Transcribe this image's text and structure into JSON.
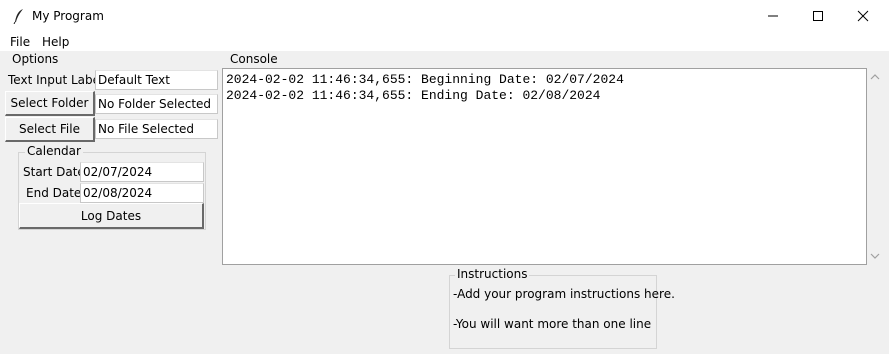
{
  "window": {
    "title": "My Program"
  },
  "menu": {
    "items": [
      "File",
      "Help"
    ]
  },
  "options": {
    "group_label": "Options",
    "text_input_label": "Text Input Label",
    "text_input_value": "Default Text",
    "select_folder_label": "Select Folder",
    "folder_value": "No Folder Selected",
    "select_file_label": "Select File",
    "file_value": "No File Selected"
  },
  "calendar": {
    "group_label": "Calendar",
    "start_label": "Start Date:",
    "start_value": "02/07/2024",
    "end_label": "End Date:",
    "end_value": "02/08/2024",
    "log_button_label": "Log Dates"
  },
  "console": {
    "group_label": "Console",
    "lines": [
      "2024-02-02 11:46:34,655: Beginning Date: 02/07/2024",
      "2024-02-02 11:46:34,655: Ending Date: 02/08/2024"
    ]
  },
  "instructions": {
    "group_label": "Instructions",
    "lines": [
      "-Add your program instructions here.",
      "-You will want more than one line"
    ]
  }
}
